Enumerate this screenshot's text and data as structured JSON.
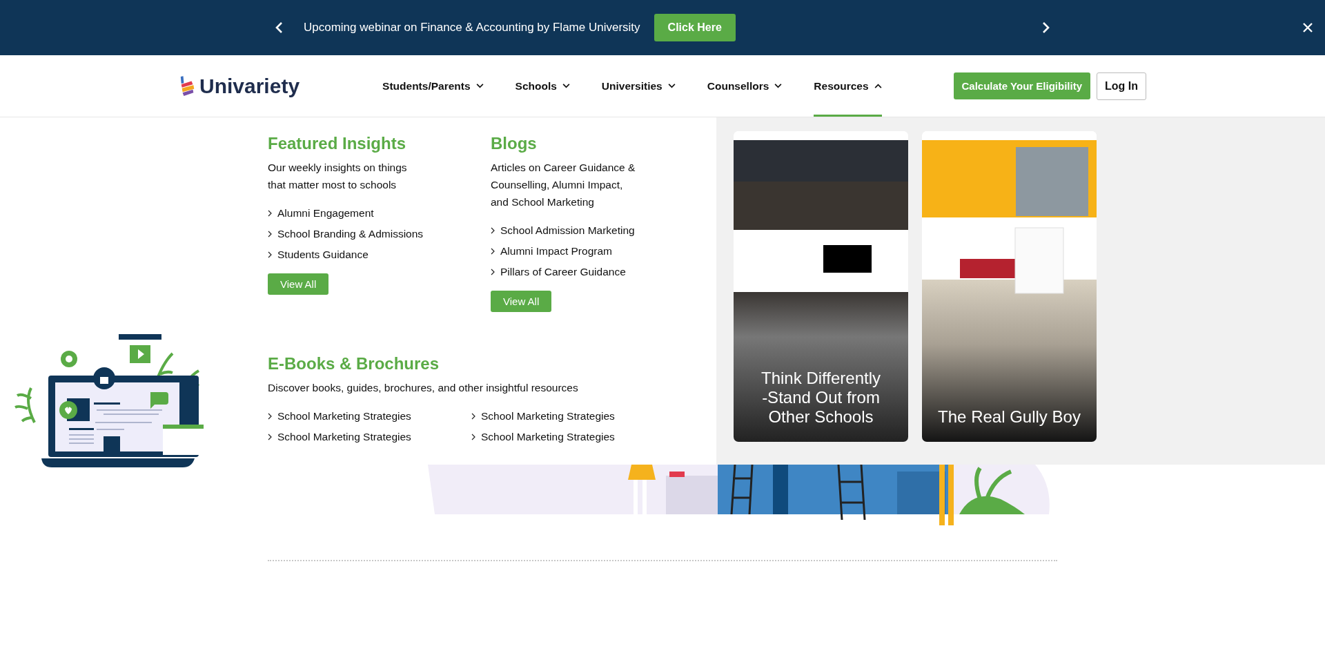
{
  "announcement": {
    "text": "Upcoming webinar on Finance & Accounting by Flame University",
    "button": "Click Here"
  },
  "header": {
    "logo": "Univariety",
    "nav": [
      {
        "label": "Students/Parents",
        "expanded": false
      },
      {
        "label": "Schools",
        "expanded": false
      },
      {
        "label": "Universities",
        "expanded": false
      },
      {
        "label": "Counsellors",
        "expanded": false
      },
      {
        "label": "Resources",
        "expanded": true
      }
    ],
    "cta": "Calculate Your Eligibility",
    "login": "Log In"
  },
  "resources_menu": {
    "featured_insights": {
      "title": "Featured Insights",
      "description": "Our weekly insights on things that matter most to schools",
      "links": [
        "Alumni Engagement",
        "School Branding & Admissions",
        "Students Guidance"
      ],
      "button": "View All"
    },
    "blogs": {
      "title": "Blogs",
      "description": "Articles on Career Guidance & Counselling, Alumni Impact, and School Marketing",
      "links": [
        "School Admission Marketing",
        "Alumni Impact Program",
        "Pillars of Career Guidance"
      ],
      "button": "View All"
    },
    "ebooks": {
      "title": "E-Books & Brochures",
      "description": "Discover books, guides, brochures, and other insightful resources",
      "links": [
        "School Marketing Strategies",
        "School Marketing Strategies",
        "School Marketing Strategies",
        "School Marketing Strategies"
      ]
    },
    "previews": [
      {
        "kind": "city",
        "caption": "Think Differently -Stand Out from Other Schools"
      },
      {
        "kind": "yellow",
        "caption": "The Real Gully Boy"
      }
    ]
  }
}
